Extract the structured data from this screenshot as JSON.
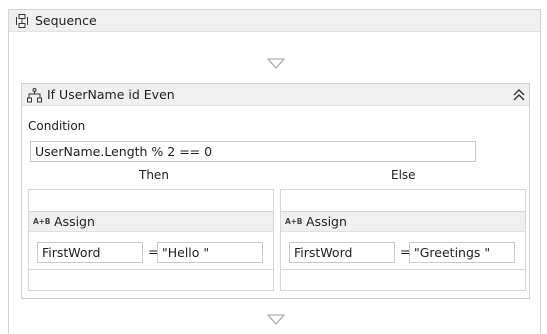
{
  "sequence": {
    "title": "Sequence",
    "icon": "sequence-icon"
  },
  "if_activity": {
    "title": "If UserName id Even",
    "icon": "if-activity-icon",
    "condition_label": "Condition",
    "condition_value": "UserName.Length % 2 == 0",
    "then_label": "Then",
    "else_label": "Else"
  },
  "then_assign": {
    "title": "Assign",
    "icon_text": "A+B",
    "to": "FirstWord",
    "operator": "=",
    "value": "\"Hello \""
  },
  "else_assign": {
    "title": "Assign",
    "icon_text": "A+B",
    "to": "FirstWord",
    "operator": "=",
    "value": "\"Greetings \""
  }
}
